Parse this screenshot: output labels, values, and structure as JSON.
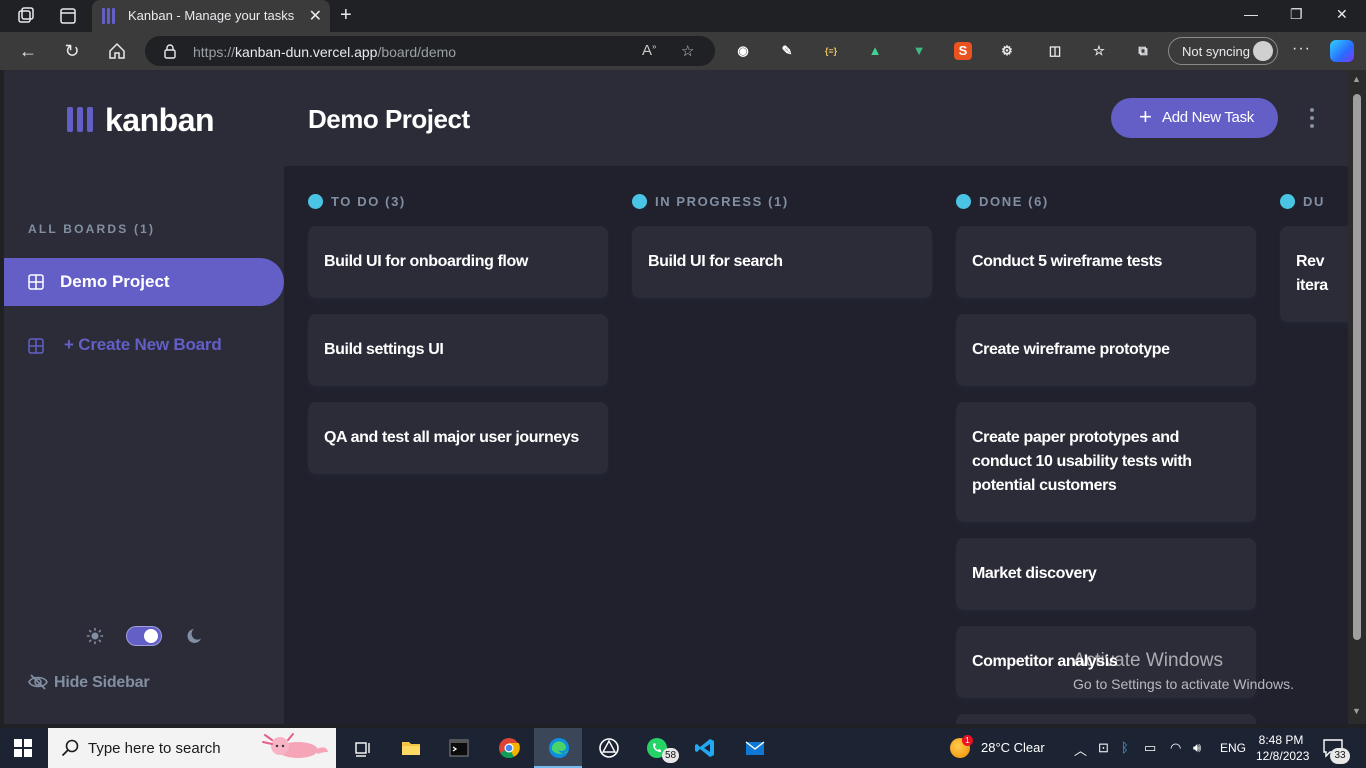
{
  "browser": {
    "tab_title": "Kanban - Manage your tasks",
    "url_prefix": "https://",
    "url_host": "kanban-dun.vercel.app",
    "url_path": "/board/demo",
    "sync_label": "Not syncing",
    "icons": [
      "workspaces-icon",
      "tab-actions-icon",
      "back-icon",
      "refresh-icon",
      "home-icon",
      "lock-icon",
      "read-aloud-icon",
      "favorite-star-icon",
      "extensions-icon",
      "split-screen-icon",
      "favorites-icon",
      "collections-icon",
      "more-icon",
      "copilot-icon"
    ]
  },
  "app": {
    "logo_text": "kanban",
    "board_title": "Demo Project",
    "add_task_label": "Add New Task",
    "colors": {
      "accent": "#635fc7",
      "sidebar_bg": "#2b2c37",
      "board_bg": "#20212c",
      "card_bg": "#2b2c37",
      "muted": "#828fa3",
      "todo_dot": "#49c4e5"
    }
  },
  "sidebar": {
    "heading": "ALL BOARDS (1)",
    "boards": [
      {
        "label": "Demo Project",
        "active": true
      }
    ],
    "create_label": "Create New Board",
    "hide_label": "Hide Sidebar",
    "theme": "dark"
  },
  "columns": [
    {
      "title": "TO DO (3)",
      "cards": [
        "Build UI for onboarding flow",
        "Build settings UI",
        "QA and test all major user journeys"
      ]
    },
    {
      "title": "IN PROGRESS (1)",
      "cards": [
        "Build UI for search"
      ]
    },
    {
      "title": "DONE (6)",
      "cards": [
        "Conduct 5 wireframe tests",
        "Create wireframe prototype",
        "Create paper prototypes and conduct 10 usability tests with potential customers",
        "Market discovery",
        "Competitor analysis",
        ""
      ]
    },
    {
      "title": "DU",
      "cards": [
        "Rev\nitera"
      ]
    }
  ],
  "watermark": {
    "line1": "Activate Windows",
    "line2": "Go to Settings to activate Windows."
  },
  "taskbar": {
    "search_placeholder": "Type here to search",
    "whatsapp_badge": "58",
    "weather": "28°C  Clear",
    "weather_alert": "1",
    "language": "ENG",
    "time": "8:48 PM",
    "date": "12/8/2023",
    "notifications": "33"
  }
}
